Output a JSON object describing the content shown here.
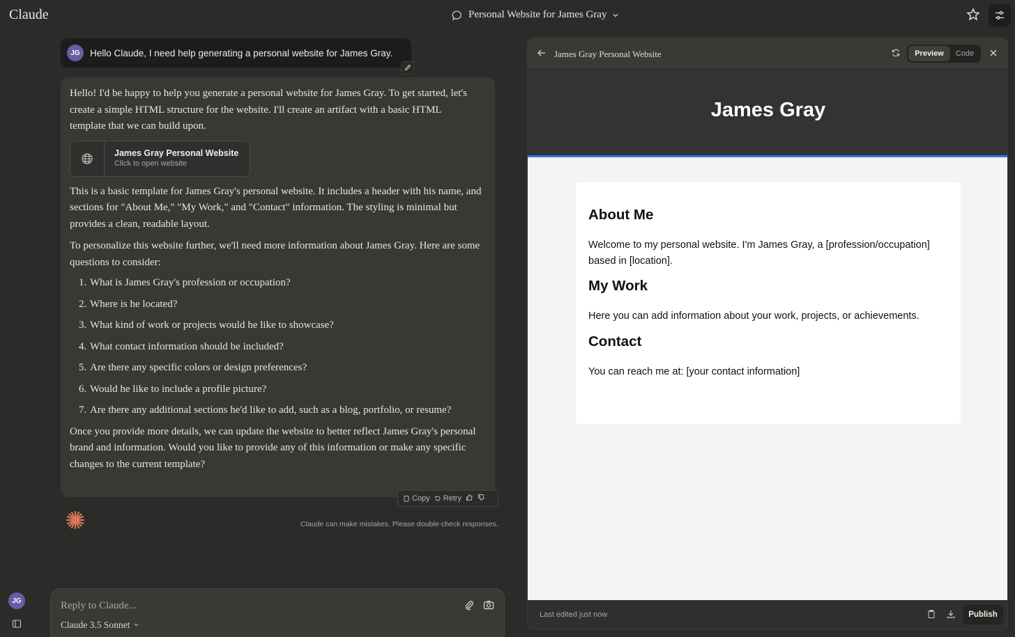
{
  "app": {
    "brand": "Claude"
  },
  "header": {
    "conversation_title": "Personal Website for James Gray",
    "icons": [
      "chat-bubble-icon",
      "chevron-down-icon",
      "star-icon",
      "sliders-icon"
    ]
  },
  "chat": {
    "user_message": {
      "avatar_initials": "JG",
      "text": "Hello Claude, I need help generating a personal website for James Gray."
    },
    "assistant": {
      "intro": "Hello! I'd be happy to help you generate a personal website for James Gray. To get started, let's create a simple HTML structure for the website. I'll create an artifact with a basic HTML template that we can build upon.",
      "artifact_card": {
        "title": "James Gray Personal Website",
        "subtitle": "Click to open website"
      },
      "para2": "This is a basic template for James Gray's personal website. It includes a header with his name, and sections for \"About Me,\" \"My Work,\" and \"Contact\" information. The styling is minimal but provides a clean, readable layout.",
      "para3": "To personalize this website further, we'll need more information about James Gray. Here are some questions to consider:",
      "questions": [
        "What is James Gray's profession or occupation?",
        "Where is he located?",
        "What kind of work or projects would he like to showcase?",
        "What contact information should be included?",
        "Are there any specific colors or design preferences?",
        "Would he like to include a profile picture?",
        "Are there any additional sections he'd like to add, such as a blog, portfolio, or resume?"
      ],
      "closing": "Once you provide more details, we can update the website to better reflect James Gray's personal brand and information. Would you like to provide any of this information or make any specific changes to the current template?"
    },
    "actions": {
      "copy": "Copy",
      "retry": "Retry"
    },
    "disclaimer": "Claude can make mistakes. Please double-check responses."
  },
  "composer": {
    "placeholder": "Reply to Claude...",
    "model": "Claude 3.5 Sonnet",
    "user_initials": "JG"
  },
  "artifact_panel": {
    "title": "James Gray Personal Website",
    "tabs": {
      "preview": "Preview",
      "code": "Code"
    },
    "active_tab": "Preview",
    "site": {
      "name": "James Gray",
      "sections": [
        {
          "heading": "About Me",
          "body": "Welcome to my personal website. I'm James Gray, a [profession/occupation] based in [location]."
        },
        {
          "heading": "My Work",
          "body": "Here you can add information about your work, projects, or achievements."
        },
        {
          "heading": "Contact",
          "body": "You can reach me at: [your contact information]"
        }
      ],
      "colors": {
        "header_bg": "#333333",
        "accent": "#2f7ad6",
        "page_bg": "#f4f4f4"
      }
    },
    "footer": {
      "status": "Last edited just now",
      "publish": "Publish"
    }
  },
  "colors": {
    "app_bg": "#2b2b29",
    "avatar": "#6b5aa6",
    "claude_orange": "#d97757"
  }
}
